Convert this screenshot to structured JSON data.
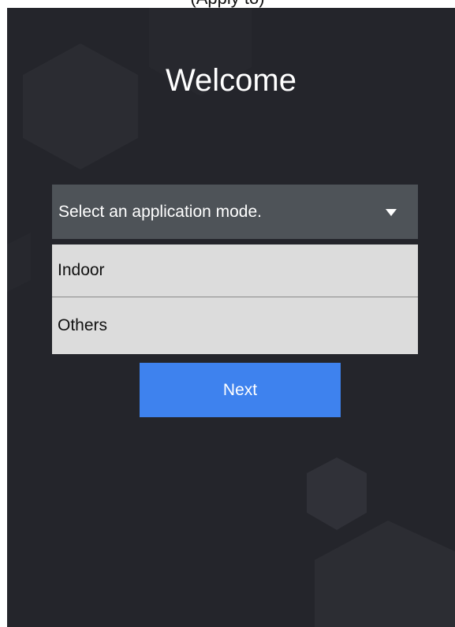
{
  "caption": {
    "text": "(Apply to)"
  },
  "screen": {
    "title": "Welcome",
    "background_color": "#24252b"
  },
  "select": {
    "placeholder": "Select an application mode.",
    "arrow_icon": "triangle-down-icon"
  },
  "options": [
    {
      "label": "Indoor"
    },
    {
      "label": "Others"
    }
  ],
  "next_button": {
    "label": "Next",
    "color": "#3e82ee"
  }
}
